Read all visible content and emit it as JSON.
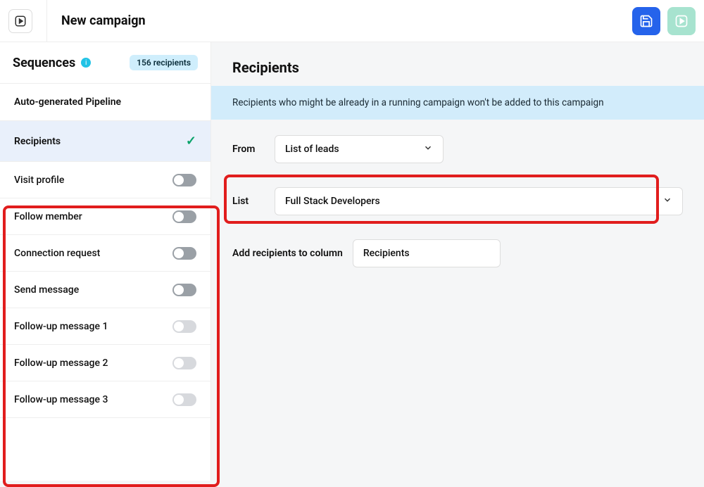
{
  "header": {
    "title": "New campaign"
  },
  "sidebar": {
    "title": "Sequences",
    "recipients_badge": "156 recipients",
    "pipeline_label": "Auto-generated Pipeline",
    "recipients_label": "Recipients",
    "items": [
      {
        "label": "Visit profile",
        "toggle_dark": true
      },
      {
        "label": "Follow member",
        "toggle_dark": true
      },
      {
        "label": "Connection request",
        "toggle_dark": true
      },
      {
        "label": "Send message",
        "toggle_dark": true
      },
      {
        "label": "Follow-up message 1",
        "toggle_dark": false
      },
      {
        "label": "Follow-up message 2",
        "toggle_dark": false
      },
      {
        "label": "Follow-up message 3",
        "toggle_dark": false
      }
    ]
  },
  "main": {
    "title": "Recipients",
    "banner": "Recipients who might be already in a running campaign won't be added to this campaign",
    "from_label": "From",
    "from_value": "List of leads",
    "list_label": "List",
    "list_value": "Full Stack Developers",
    "column_label": "Add recipients to column",
    "column_value": "Recipients"
  }
}
